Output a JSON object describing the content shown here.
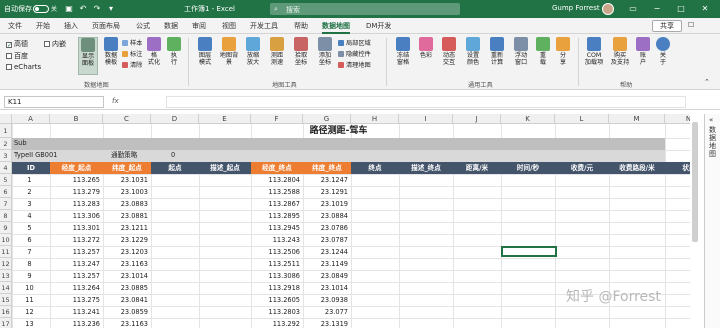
{
  "titlebar": {
    "autosave_label": "自动保存",
    "autosave_state": "关",
    "file_title": "工作簿1 - Excel",
    "search_placeholder": "搜索",
    "user_name": "Gump Forrest"
  },
  "tabs": [
    "文件",
    "开始",
    "插入",
    "页面布局",
    "公式",
    "数据",
    "审阅",
    "视图",
    "开发工具",
    "帮助",
    "数据地图",
    "DM开发"
  ],
  "active_tab": "数据地图",
  "share_label": "共享",
  "ribbon": {
    "maps": [
      {
        "label": "高德",
        "checked": true
      },
      {
        "label": "百度",
        "checked": false
      },
      {
        "label": "eCharts",
        "checked": false
      },
      {
        "label": "内嵌",
        "checked": false
      }
    ],
    "panel_btn": "显示\n面板",
    "data_btn": "数据\n模板",
    "small_a": [
      "样本",
      "标注",
      "清除"
    ],
    "format_btn": "格\n式化",
    "exec_btn": "执\n行",
    "group1": "数据地图",
    "map_btns": [
      "图层\n模式",
      "地图背\n景",
      "放缩\n放大",
      "测距\n测速",
      "拾取\n坐标",
      "添加\n坐标"
    ],
    "group2": "地图工具",
    "small_b": [
      "局部区域",
      "隐藏控件",
      "清理地图"
    ],
    "tool_btns": [
      "冻结\n窗格",
      "色彩",
      "动态\n交互",
      "设置\n颜色",
      "重新\n计算",
      "浮动\n窗口",
      "重\n载",
      "分\n享"
    ],
    "group3": "通用工具",
    "help_btns": [
      "COM\n加载项",
      "购买\n及支持",
      "账\n户",
      "关\n于"
    ],
    "group4": "帮助"
  },
  "formula_bar": {
    "cell_ref": "K11",
    "fx": "fx",
    "value": ""
  },
  "columns": [
    "A",
    "B",
    "C",
    "D",
    "E",
    "F",
    "G",
    "H",
    "I",
    "J",
    "K",
    "L",
    "M",
    "N",
    "O"
  ],
  "sheet": {
    "title": "路径测距-驾车",
    "row2": "Sub",
    "row3": {
      "type": "TypeII GB001",
      "policy_label": "通勤策略",
      "policy_value": "0"
    },
    "headers": [
      "ID",
      "经度_起点",
      "纬度_起点",
      "起点",
      "描述_起点",
      "经度_终点",
      "纬度_终点",
      "终点",
      "描述_终点",
      "距离/米",
      "时间/秒",
      "收费/元",
      "收费路段/米",
      "状态"
    ],
    "rows": [
      [
        "1",
        "113.265",
        "23.1031",
        "113.2804",
        "23.1247"
      ],
      [
        "2",
        "113.279",
        "23.1003",
        "113.2588",
        "23.1291"
      ],
      [
        "3",
        "113.283",
        "23.0883",
        "113.2867",
        "23.1019"
      ],
      [
        "4",
        "113.306",
        "23.0881",
        "113.2895",
        "23.0884"
      ],
      [
        "5",
        "113.301",
        "23.1211",
        "113.2945",
        "23.0786"
      ],
      [
        "6",
        "113.272",
        "23.1229",
        "113.243",
        "23.0787"
      ],
      [
        "7",
        "113.257",
        "23.1203",
        "113.2506",
        "23.1244"
      ],
      [
        "8",
        "113.247",
        "23.1163",
        "113.2511",
        "23.1149"
      ],
      [
        "9",
        "113.257",
        "23.1014",
        "113.3086",
        "23.0849"
      ],
      [
        "10",
        "113.264",
        "23.0885",
        "113.2918",
        "23.1014"
      ],
      [
        "11",
        "113.275",
        "23.0841",
        "113.2605",
        "23.0938"
      ],
      [
        "12",
        "113.241",
        "23.0859",
        "113.2803",
        "23.077"
      ],
      [
        "13",
        "113.236",
        "23.1163",
        "113.292",
        "23.1319"
      ],
      [
        "14",
        "113.309",
        "23.0994",
        "113.304",
        "23.1232"
      ]
    ]
  },
  "side_panel": "数据地图",
  "watermark": "知乎 @Forrest",
  "colors": {
    "excel_green": "#217346",
    "header_dark": "#44546a",
    "header_orange": "#ed7d31",
    "band_gray": "#bfbfbf"
  }
}
